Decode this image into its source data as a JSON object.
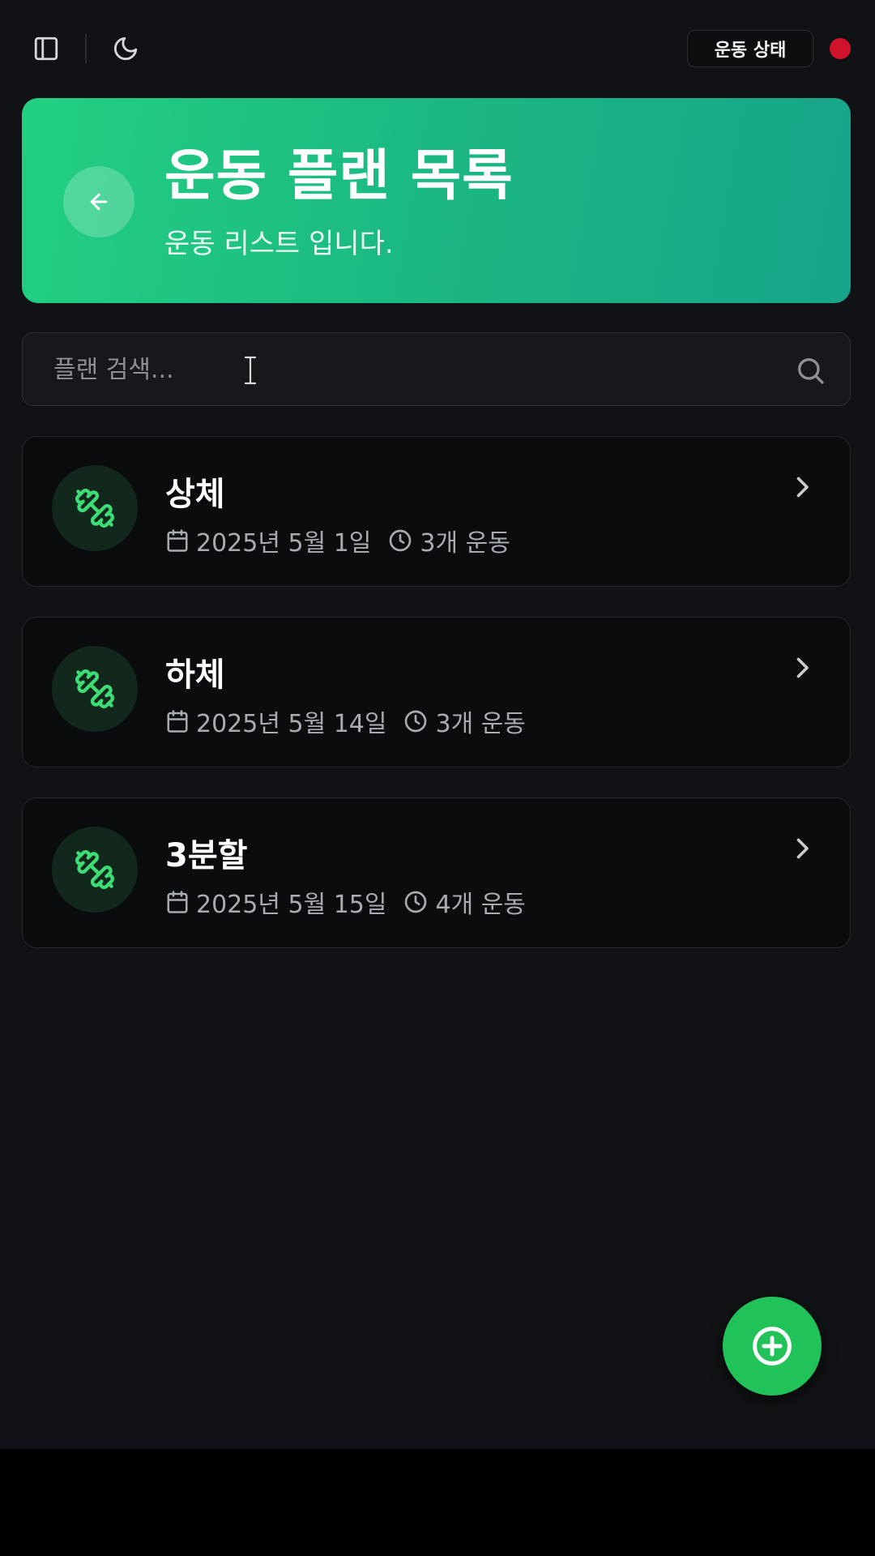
{
  "topbar": {
    "sidebar_icon": "sidebar-toggle-icon",
    "theme_icon": "moon-icon",
    "status_label": "운동 상태",
    "status_color": "#d0132a"
  },
  "hero": {
    "title": "운동 플랜 목록",
    "subtitle": "운동 리스트 입니다.",
    "back_icon": "arrow-left-icon",
    "gradient": [
      "#22d081",
      "#17a58a"
    ]
  },
  "search": {
    "placeholder": "플랜 검색...",
    "value": "",
    "icon": "search-icon"
  },
  "plans": [
    {
      "name": "상체",
      "date": "2025년 5월 1일",
      "count": "3개 운동"
    },
    {
      "name": "하체",
      "date": "2025년 5월 14일",
      "count": "3개 운동"
    },
    {
      "name": "3분할",
      "date": "2025년 5월 15일",
      "count": "4개 운동"
    }
  ],
  "fab": {
    "icon": "plus-circle-icon",
    "color": "#22c25a"
  },
  "accent": "#22c55e"
}
